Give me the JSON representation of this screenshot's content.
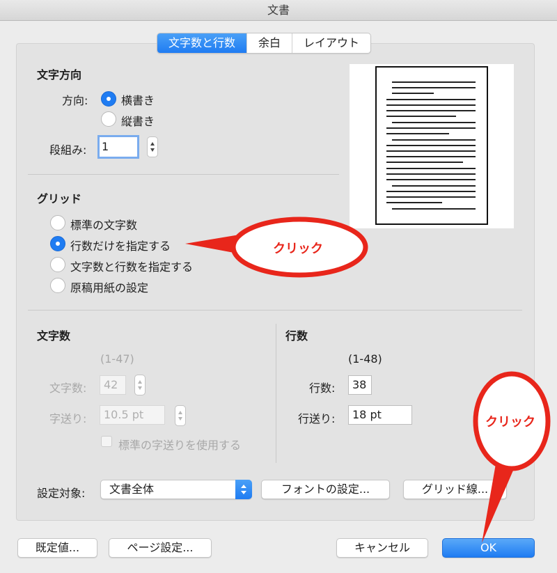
{
  "window": {
    "title": "文書"
  },
  "tabs": [
    {
      "label": "文字数と行数",
      "active": true
    },
    {
      "label": "余白",
      "active": false
    },
    {
      "label": "レイアウト",
      "active": false
    }
  ],
  "text_direction": {
    "title": "文字方向",
    "direction_label": "方向:",
    "options": [
      {
        "label": "横書き",
        "selected": true
      },
      {
        "label": "縦書き",
        "selected": false
      }
    ],
    "columns_label": "段組み:",
    "columns_value": "1"
  },
  "grid": {
    "title": "グリッド",
    "options": [
      {
        "label": "標準の文字数",
        "selected": false
      },
      {
        "label": "行数だけを指定する",
        "selected": true
      },
      {
        "label": "文字数と行数を指定する",
        "selected": false
      },
      {
        "label": "原稿用紙の設定",
        "selected": false
      }
    ]
  },
  "chars": {
    "title": "文字数",
    "range": "(1-47)",
    "count_label": "文字数:",
    "count_value": "42",
    "pitch_label": "字送り:",
    "pitch_value": "10.5 pt",
    "standard_pitch_label": "標準の字送りを使用する",
    "standard_pitch_checked": false
  },
  "lines": {
    "title": "行数",
    "range": "(1-48)",
    "count_label": "行数:",
    "count_value": "38",
    "pitch_label": "行送り:",
    "pitch_value": "18 pt"
  },
  "apply_to": {
    "label": "設定対象:",
    "selected": "文書全体"
  },
  "buttons": {
    "font_settings": "フォントの設定...",
    "grid_lines": "グリッド線...",
    "defaults": "既定値...",
    "page_setup": "ページ設定...",
    "cancel": "キャンセル",
    "ok": "OK"
  },
  "annotations": {
    "callout_grid": "クリック",
    "callout_ok": "クリック"
  },
  "colors": {
    "accent": "#1f7cf2",
    "callout": "#e8261b"
  }
}
